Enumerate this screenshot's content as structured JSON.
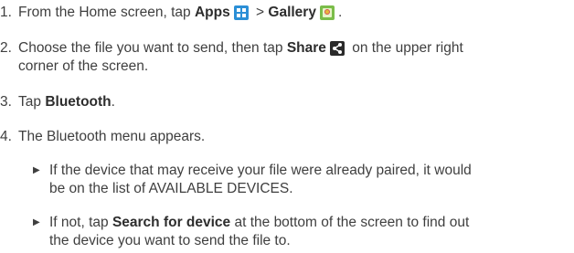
{
  "steps": [
    {
      "number": "1.",
      "parts": {
        "a": "From the Home screen, tap ",
        "apps": "Apps",
        "gt": " > ",
        "gallery": "Gallery",
        "end": "."
      }
    },
    {
      "number": "2.",
      "parts": {
        "a": "Choose the file you want to send, then tap ",
        "share": "Share",
        "b": " on the upper right",
        "c": "corner of the screen."
      }
    },
    {
      "number": "3.",
      "parts": {
        "a": "Tap ",
        "bt": "Bluetooth",
        "end": "."
      }
    },
    {
      "number": "4.",
      "parts": {
        "a": "The Bluetooth menu appears."
      }
    }
  ],
  "bullets": [
    {
      "line1": "If the device that may receive your file were already paired, it would",
      "line2": "be on the list of AVAILABLE DEVICES."
    },
    {
      "pre": "If not, tap ",
      "link": "Search for device",
      "post": " at the bottom of the screen to find out",
      "line2": "the device you want to send the file to."
    }
  ],
  "icons": {
    "apps": "apps-grid-icon",
    "gallery": "gallery-icon",
    "share": "share-icon",
    "bullet": "triangle-bullet-icon"
  },
  "colors": {
    "text": "#3f3f3f",
    "bold": "#2d2d2d",
    "apps_icon": "#2b8fd6",
    "gallery_icon": "#7bbd4a",
    "share_icon": "#2a2a2a"
  }
}
